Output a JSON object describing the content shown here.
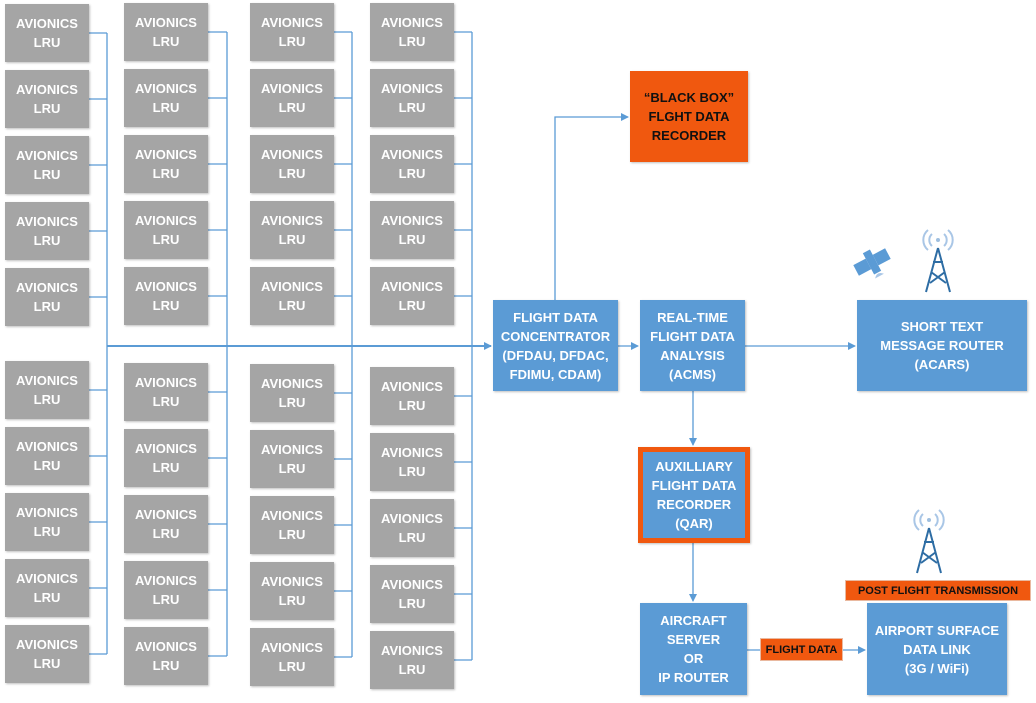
{
  "colors": {
    "line": "#5b9bd5",
    "lru": "#a5a5a5",
    "block": "#5b9bd5",
    "highlight": "#f0580f"
  },
  "lru_label": "AVIONICS\nLRU",
  "lru_groups": 8,
  "lru_per_group": 5,
  "nodes": {
    "black_box": "“BLACK BOX”\nFLGHT DATA\nRECORDER",
    "concentrator": "FLIGHT DATA\nCONCENTRATOR\n(DFDAU, DFDAC,\nFDIMU, CDAM)",
    "realtime": "REAL-TIME\nFLIGHT DATA\nANALYSIS\n(ACMS)",
    "acars": "SHORT TEXT\nMESSAGE ROUTER\n(ACARS)",
    "qar": "AUXILLIARY\nFLIGHT DATA\nRECORDER\n(QAR)",
    "server": "AIRCRAFT\nSERVER\nOR\nIP ROUTER",
    "surface_link": "AIRPORT SURFACE\nDATA LINK\n(3G / WiFi)"
  },
  "labels": {
    "flight_data": "FLIGHT DATA",
    "post_flight": "POST FLIGHT TRANSMISSION"
  },
  "icons": [
    "satellite-icon",
    "radio-tower-icon",
    "radio-tower-icon"
  ]
}
